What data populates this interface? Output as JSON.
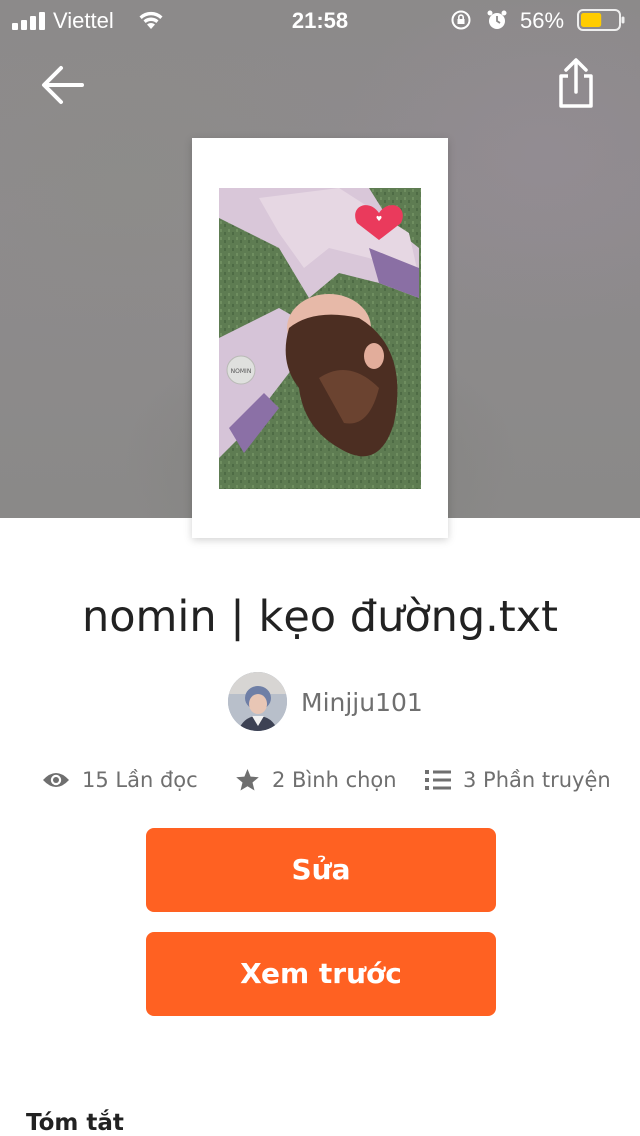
{
  "status_bar": {
    "carrier": "Viettel",
    "time": "21:58",
    "battery_percent": "56%",
    "battery_level": 0.56,
    "battery_color": "#ffcc00"
  },
  "nav": {
    "back_icon": "arrow-left-icon",
    "share_icon": "share-icon"
  },
  "story": {
    "title": "nomin | kẹo đường.txt",
    "author": "Minjju101",
    "cover_sticker_text": "NOMIN"
  },
  "stats": {
    "reads": "15 Lần đọc",
    "votes": "2 Bình chọn",
    "parts": "3 Phần truyện"
  },
  "actions": {
    "edit_label": "Sửa",
    "preview_label": "Xem trước"
  },
  "sections": {
    "summary_heading": "Tóm tắt"
  },
  "colors": {
    "accent": "#ff6122",
    "text_primary": "#222222",
    "text_secondary": "#6f6f6f"
  }
}
